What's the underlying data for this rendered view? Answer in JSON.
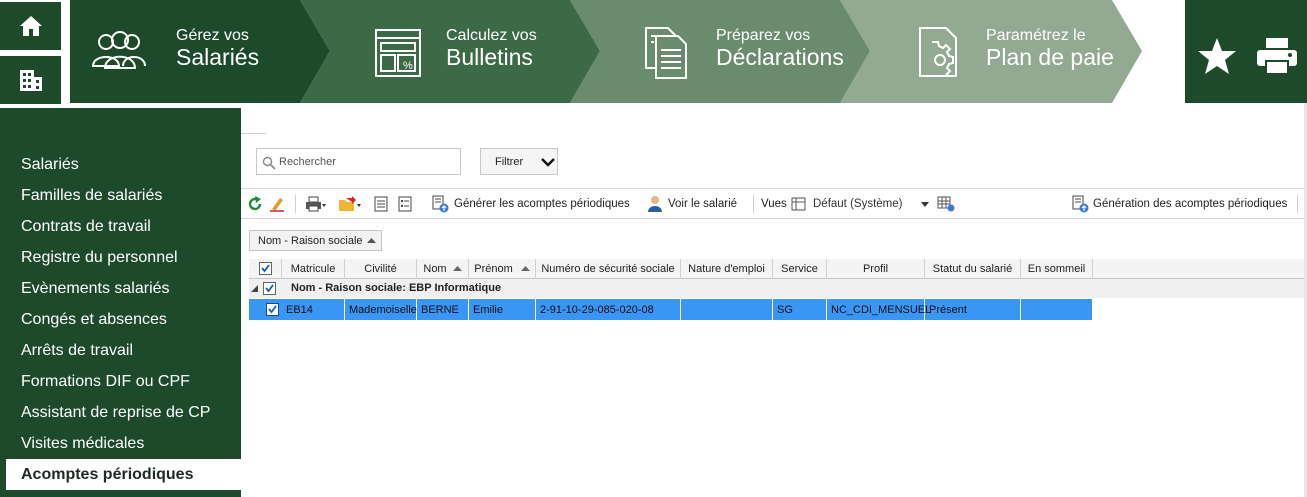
{
  "ribbon": {
    "steps": [
      {
        "small": "Gérez vos",
        "big": "Salariés"
      },
      {
        "small": "Calculez vos",
        "big": "Bulletins"
      },
      {
        "small": "Préparez vos",
        "big": "Déclarations"
      },
      {
        "small": "Paramétrez le",
        "big": "Plan de paie"
      }
    ],
    "colors": [
      "#1e4a2c",
      "#3c6a47",
      "#6b8b6e",
      "#93a991"
    ]
  },
  "sidebar": {
    "items": [
      "Salariés",
      "Familles de salariés",
      "Contrats de travail",
      "Registre du personnel",
      "Evènements salariés",
      "Congés et absences",
      "Arrêts de travail",
      "Formations DIF ou CPF",
      "Assistant de reprise de CP",
      "Visites médicales"
    ],
    "active": "Acomptes périodiques"
  },
  "search": {
    "placeholder": "Rechercher"
  },
  "filter": {
    "label": "Filtrer"
  },
  "toolbar": {
    "generate_label": "Générer les acomptes périodiques",
    "view_employee_label": "Voir le salarié",
    "views_label": "Vues",
    "views_value": "Défaut (Système)",
    "generation_label": "Génération des acomptes périodiques"
  },
  "grouping": {
    "chip": "Nom - Raison sociale"
  },
  "grid": {
    "columns": [
      "Matricule",
      "Civilité",
      "Nom",
      "Prénom",
      "Numéro de sécurité sociale",
      "Nature d'emploi",
      "Service",
      "Profil",
      "Statut du salarié",
      "En sommeil"
    ],
    "group_label": "Nom - Raison sociale: EBP Informatique",
    "rows": [
      [
        "EB14",
        "Mademoiselle",
        "BERNE",
        "Emilie",
        "2-91-10-29-085-020-08",
        "",
        "SG",
        "NC_CDI_MENSUEL",
        "Présent",
        ""
      ]
    ]
  }
}
